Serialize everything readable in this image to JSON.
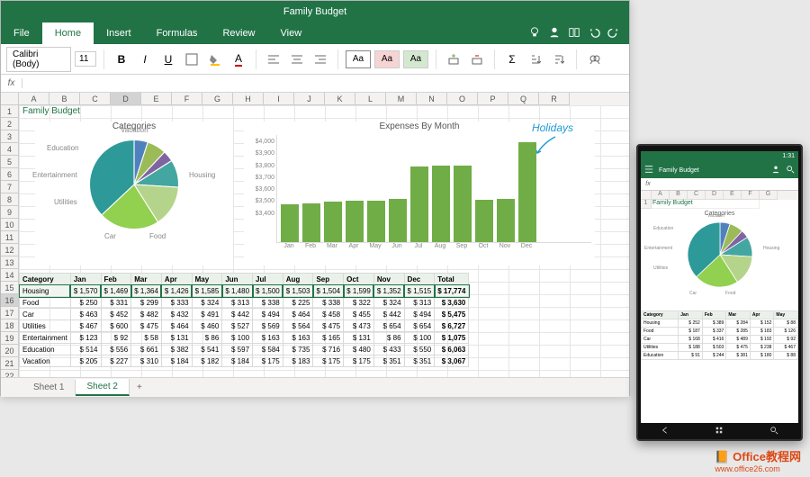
{
  "title": "Family Budget",
  "tabs": [
    "File",
    "Home",
    "Insert",
    "Formulas",
    "Review",
    "View"
  ],
  "active_tab": "Home",
  "font": {
    "name": "Calibri (Body)",
    "size": "11"
  },
  "aa_variants": [
    "Aa",
    "Aa",
    "Aa"
  ],
  "formula": "",
  "columns": [
    "A",
    "B",
    "C",
    "D",
    "E",
    "F",
    "G",
    "H",
    "I",
    "J",
    "K",
    "L",
    "M",
    "N",
    "O",
    "P",
    "Q",
    "R"
  ],
  "row_numbers": [
    1,
    2,
    3,
    4,
    5,
    6,
    7,
    8,
    9,
    10,
    11,
    12,
    13,
    14,
    15,
    16,
    17,
    18,
    19,
    20,
    21,
    22
  ],
  "a1_text": "Family Budget",
  "chart_data": [
    {
      "type": "pie",
      "title": "Categories",
      "series": [
        {
          "name": "Vacation",
          "value": 5,
          "color": "#4f81bd"
        },
        {
          "name": "Education",
          "value": 7,
          "color": "#9bbb59"
        },
        {
          "name": "Entertainment",
          "value": 4,
          "color": "#8064a2"
        },
        {
          "name": "Utilities",
          "value": 10,
          "color": "#44a6a0"
        },
        {
          "name": "Car",
          "value": 15,
          "color": "#b5d48b"
        },
        {
          "name": "Food",
          "value": 22,
          "color": "#92d050"
        },
        {
          "name": "Housing",
          "value": 37,
          "color": "#2e9999"
        }
      ]
    },
    {
      "type": "bar",
      "title": "Expenses By Month",
      "annotation": "Holidays",
      "ylim": [
        3400,
        4000
      ],
      "yticks": [
        "$4,000",
        "$3,900",
        "$3,800",
        "$3,700",
        "$3,600",
        "$3,500",
        "$3,400"
      ],
      "categories": [
        "Jan",
        "Feb",
        "Mar",
        "Apr",
        "May",
        "Jun",
        "Jul",
        "Aug",
        "Sep",
        "Oct",
        "Nov",
        "Dec"
      ],
      "values": [
        3615,
        3619,
        3627,
        3636,
        3635,
        3645,
        3826,
        3830,
        3834,
        3638,
        3642,
        3967
      ]
    }
  ],
  "table": {
    "headers": [
      "Category",
      "Jan",
      "Feb",
      "Mar",
      "Apr",
      "May",
      "Jun",
      "Jul",
      "Aug",
      "Sep",
      "Oct",
      "Nov",
      "Dec",
      "Total"
    ],
    "rows": [
      {
        "cat": "Housing",
        "cells": [
          1570,
          1469,
          1364,
          1426,
          1585,
          1480,
          1500,
          1503,
          1504,
          1599,
          1352,
          1515
        ],
        "total": 17774
      },
      {
        "cat": "Food",
        "cells": [
          250,
          331,
          299,
          333,
          324,
          313,
          338,
          225,
          338,
          322,
          324,
          313
        ],
        "total": 3630
      },
      {
        "cat": "Car",
        "cells": [
          463,
          452,
          482,
          432,
          491,
          442,
          494,
          464,
          458,
          455,
          442,
          494
        ],
        "total": 5475
      },
      {
        "cat": "Utilities",
        "cells": [
          467,
          600,
          475,
          464,
          460,
          527,
          569,
          564,
          475,
          473,
          654,
          654
        ],
        "total": 6727
      },
      {
        "cat": "Entertainment",
        "cells": [
          123,
          92,
          58,
          131,
          86,
          100,
          163,
          163,
          165,
          131,
          86,
          100
        ],
        "total": 1075
      },
      {
        "cat": "Education",
        "cells": [
          514,
          556,
          661,
          382,
          541,
          597,
          584,
          735,
          716,
          480,
          433,
          550
        ],
        "total": 6063
      },
      {
        "cat": "Vacation",
        "cells": [
          205,
          227,
          310,
          184,
          182,
          184,
          175,
          183,
          175,
          175,
          351,
          351
        ],
        "total": 3067
      }
    ],
    "selected_row": 0,
    "selected_col": 2
  },
  "sheet_tabs": [
    "Sheet 1",
    "Sheet 2"
  ],
  "active_sheet": "Sheet 2",
  "phone": {
    "time": "1:31",
    "title": "Family Budget",
    "a1": "Family Budget",
    "cols": [
      "A",
      "B",
      "C",
      "D",
      "E",
      "F",
      "G"
    ],
    "table_headers": [
      "Category",
      "Jan",
      "Feb",
      "Mar",
      "Apr",
      "May"
    ],
    "table_rows": [
      {
        "cat": "Housing",
        "cells": [
          252,
          389,
          284,
          152,
          88
        ]
      },
      {
        "cat": "Food",
        "cells": [
          187,
          337,
          285,
          183,
          126
        ]
      },
      {
        "cat": "Car",
        "cells": [
          168,
          416,
          489,
          192,
          92
        ]
      },
      {
        "cat": "Utilities",
        "cells": [
          188,
          503,
          475,
          238,
          467
        ]
      },
      {
        "cat": "Education",
        "cells": [
          91,
          244,
          381,
          180,
          88
        ]
      }
    ]
  },
  "watermark": {
    "line1": "Office教程网",
    "line2": "www.office26.com"
  }
}
